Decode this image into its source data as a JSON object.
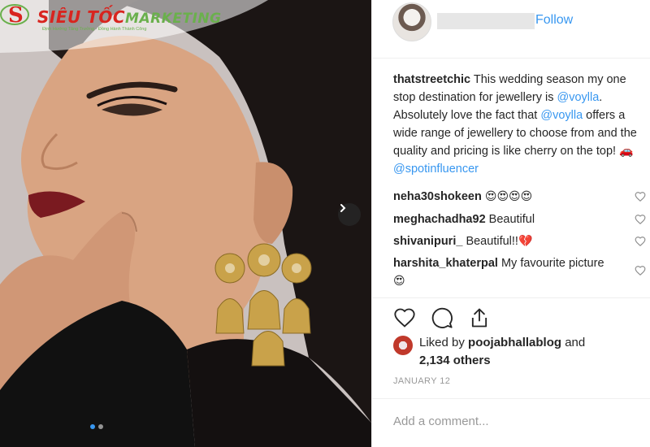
{
  "watermark": {
    "brand_main": "SIÊU TỐC",
    "brand_accent": "MARKETING",
    "tagline": "Định Hướng Tăng Trưởng - Đồng Hành Thành Công"
  },
  "post": {
    "image_alt": "",
    "carousel": {
      "slide_count": 2,
      "active_index": 0
    }
  },
  "header": {
    "username": "",
    "follow_label": "Follow"
  },
  "caption": {
    "username": "thatstreetchic",
    "text_1": " This wedding season my one stop destination for jewellery is ",
    "mention_1": "@voylla",
    "text_2": ". Absolutely love the fact that ",
    "mention_2": "@voylla",
    "text_3": " offers a wide range of jewellery to choose from and the quality and pricing is like cherry on the top! ",
    "emoji": "🚗",
    "mention_3": "@spotinfluencer"
  },
  "comments": [
    {
      "username": "neha30shokeen",
      "text": "",
      "emoji": "😍😍😍😍"
    },
    {
      "username": "meghachadha92",
      "text": " Beautiful",
      "emoji": ""
    },
    {
      "username": "shivanipuri_",
      "text": " Beautiful!!",
      "emoji": "💔"
    },
    {
      "username": "harshita_khaterpal",
      "text": " My favourite picture ",
      "emoji": "😍"
    }
  ],
  "actions": {
    "like_icon": "heart-icon",
    "comment_icon": "comment-icon",
    "share_icon": "share-icon"
  },
  "likes": {
    "prefix": "Liked by ",
    "liker": "poojabhallablog",
    "middle": " and",
    "count_text": "2,134 others"
  },
  "date": "JANUARY 12",
  "add_comment": {
    "placeholder": "Add a comment..."
  },
  "colors": {
    "link": "#3897f0",
    "watermark_red": "#d8241f",
    "watermark_green": "#6ab04c",
    "muted": "#999999"
  }
}
